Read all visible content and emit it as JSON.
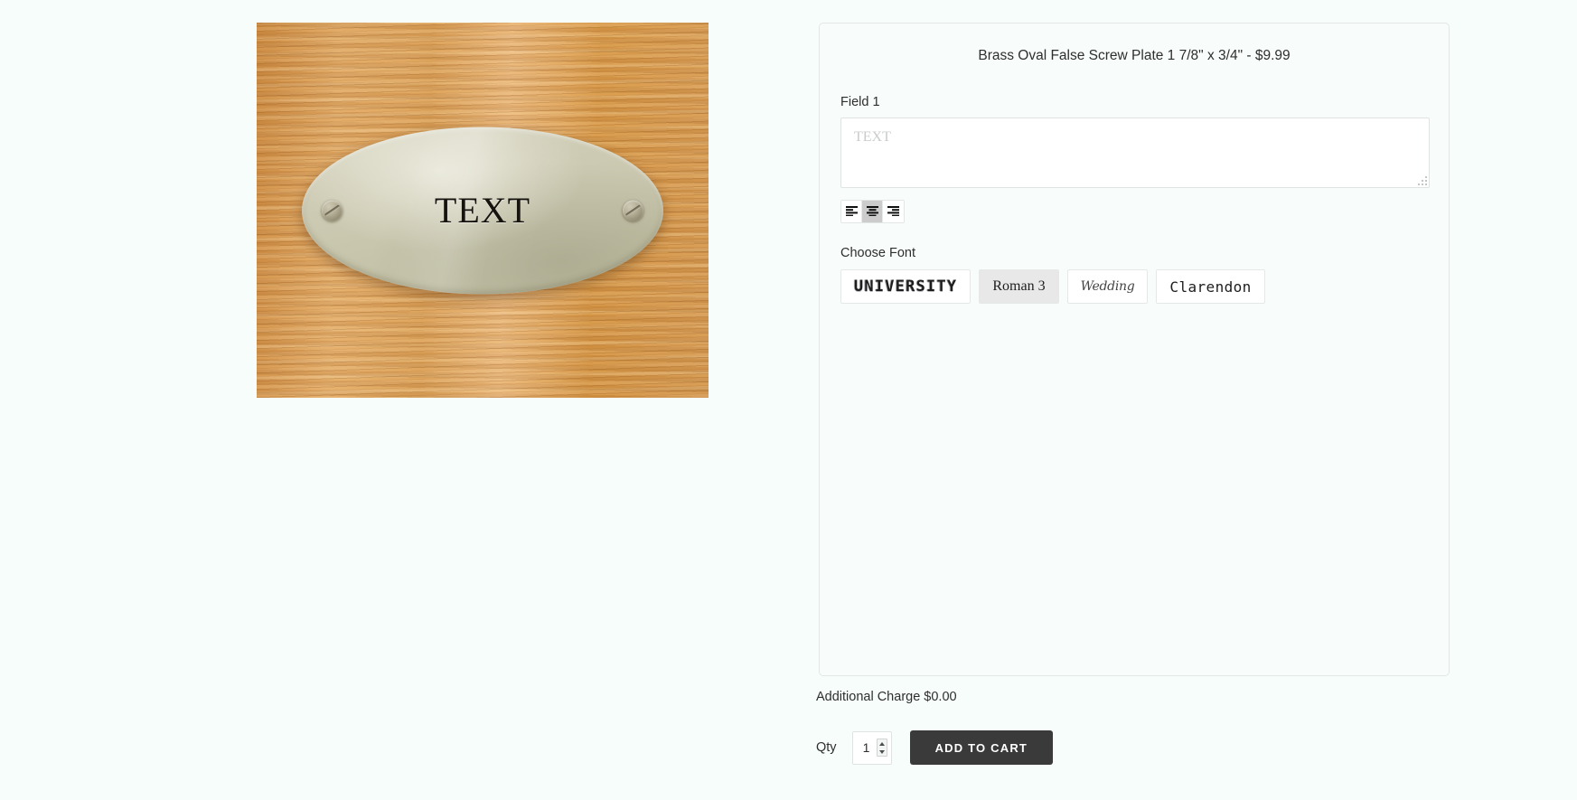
{
  "product": {
    "title": "Brass Oval False Screw Plate 1 7/8\" x 3/4\" - $9.99",
    "preview": {
      "engraved_text": "TEXT",
      "plate_material": "brass-oval-plate",
      "background": "oak-wood",
      "screw_count": 2
    }
  },
  "customizer": {
    "field_label": "Field 1",
    "text_input": {
      "value": "",
      "placeholder": "TEXT"
    },
    "alignment": {
      "options": [
        {
          "id": "left",
          "label": "Align Left",
          "icon": "align-left-icon",
          "selected": false
        },
        {
          "id": "center",
          "label": "Align Center",
          "icon": "align-center-icon",
          "selected": true
        },
        {
          "id": "right",
          "label": "Align Right",
          "icon": "align-right-icon",
          "selected": false
        }
      ],
      "selected": "center"
    },
    "choose_font_label": "Choose Font",
    "fonts": [
      {
        "id": "university",
        "label": "UNIVERSITY",
        "selected": false
      },
      {
        "id": "roman3",
        "label": "Roman 3",
        "selected": true
      },
      {
        "id": "wedding",
        "label": "Wedding",
        "selected": false
      },
      {
        "id": "clarendon",
        "label": "Clarendon",
        "selected": false
      }
    ],
    "selected_font": "Roman 3"
  },
  "purchase": {
    "additional_charge_label": "Additional Charge $0.00",
    "qty_label": "Qty",
    "qty_value": "1",
    "add_to_cart_label": "ADD TO CART"
  },
  "colors": {
    "page_background": "#f7fdfb",
    "card_background": "#f8fdfc",
    "card_border": "#e3e8e7",
    "text": "#2e2e2e",
    "placeholder": "#c8cccb",
    "active_toggle": "#cccccc",
    "selected_font_bg": "#e8e8e8",
    "add_to_cart_bg": "#3a3a3a",
    "add_to_cart_text": "#ffffff",
    "wood": "#d79a4f",
    "plate": "#cfcdb6"
  }
}
